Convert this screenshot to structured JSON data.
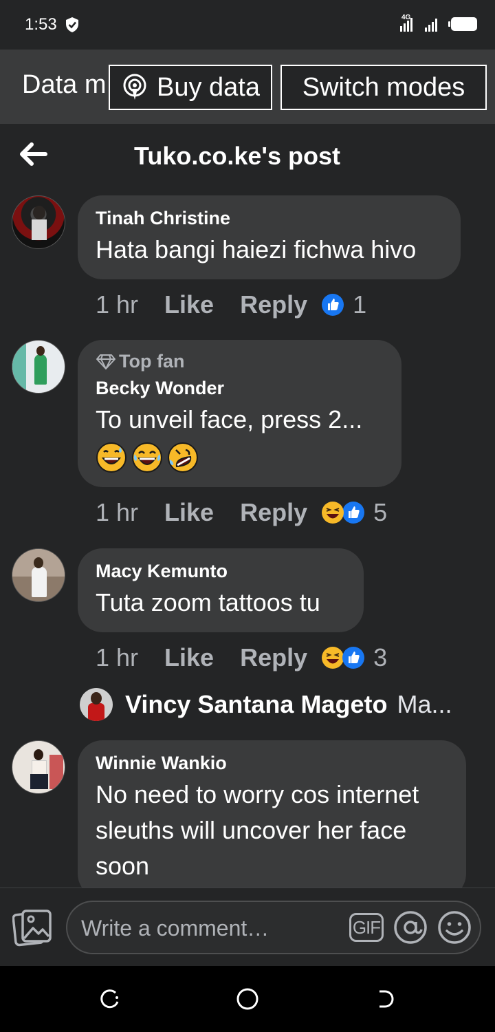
{
  "status_bar": {
    "time": "1:53",
    "network": "4G"
  },
  "data_banner": {
    "mode_text": "Data m",
    "buy_label": "Buy data",
    "switch_label": "Switch modes"
  },
  "header": {
    "title": "Tuko.co.ke's post"
  },
  "comments": [
    {
      "author": "Tinah Christine",
      "text": "Hata bangi haiezi fichwa hivo",
      "time": "1 hr",
      "like": "Like",
      "reply": "Reply",
      "reaction_count": "1",
      "reactions": [
        "like"
      ]
    },
    {
      "badge": "Top fan",
      "author": "Becky Wonder",
      "text": "To unveil face, press 2...",
      "emojis": [
        "😅",
        "😂",
        "🤣"
      ],
      "time": "1 hr",
      "like": "Like",
      "reply": "Reply",
      "reaction_count": "5",
      "reactions": [
        "haha",
        "like"
      ]
    },
    {
      "author": "Macy Kemunto",
      "text": "Tuta zoom tattoos tu",
      "time": "1 hr",
      "like": "Like",
      "reply": "Reply",
      "reaction_count": "3",
      "reactions": [
        "haha",
        "like"
      ]
    },
    {
      "author": "Winnie Wankio",
      "text": "No need to worry cos internet sleuths will uncover her face soon"
    }
  ],
  "reply_preview": {
    "name": "Vincy Santana Mageto",
    "snippet": "Ma..."
  },
  "composer": {
    "placeholder": "Write a comment…",
    "gif_label": "GIF"
  },
  "colors": {
    "background": "#242526",
    "bubble": "#3a3b3c",
    "like_blue": "#1877f2",
    "haha_yellow": "#f7b928"
  }
}
